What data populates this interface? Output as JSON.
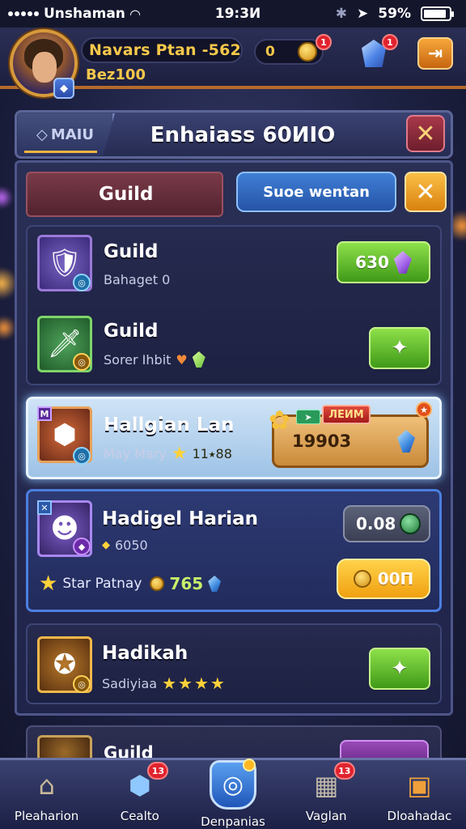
{
  "status_bar": {
    "carrier": "Unshaman",
    "time": "19:3И",
    "battery_pct": "59%"
  },
  "player": {
    "name": "Navars Ptan -562",
    "level": "Bez100",
    "coins": "0",
    "coin_badge": "1",
    "gem_badge": "1"
  },
  "panel": {
    "menu_label": "MAIU",
    "title": "Enhaiass 60ИIO",
    "close_glyph": "✕"
  },
  "tabs": {
    "active": "Guild",
    "secondary": "Suoe wentan"
  },
  "items": [
    {
      "title": "Guild",
      "subtitle": "Bahaget 0",
      "button_value": "630"
    },
    {
      "title": "Guild",
      "subtitle": "Sorer Ihbit"
    },
    {
      "corner": "M",
      "title": "Hallgian Lan",
      "subtitle": "May Mary",
      "subtitle_value": "11⭑88",
      "reward_ribbon": "ЛЕИМ",
      "reward_value": "19903"
    },
    {
      "title": "Hadigel Harian",
      "subtitle": "6050",
      "extra_label": "Star Patnay",
      "extra_value": "765",
      "gray_value": "0.08",
      "yellow_value": "00П"
    },
    {
      "title": "Hadikah",
      "subtitle": "Sadiyiaa"
    }
  ],
  "partial_item": {
    "title": "Guild"
  },
  "bottom_nav": [
    {
      "label": "Pleaharion",
      "icon": "house-icon"
    },
    {
      "label": "Cealto",
      "icon": "gem-icon",
      "badge": "13"
    },
    {
      "label": "Denpanias",
      "icon": "shield-target-icon"
    },
    {
      "label": "Vaglan",
      "icon": "shop-icon",
      "badge": "13"
    },
    {
      "label": "Dloahadac",
      "icon": "box-icon"
    }
  ]
}
